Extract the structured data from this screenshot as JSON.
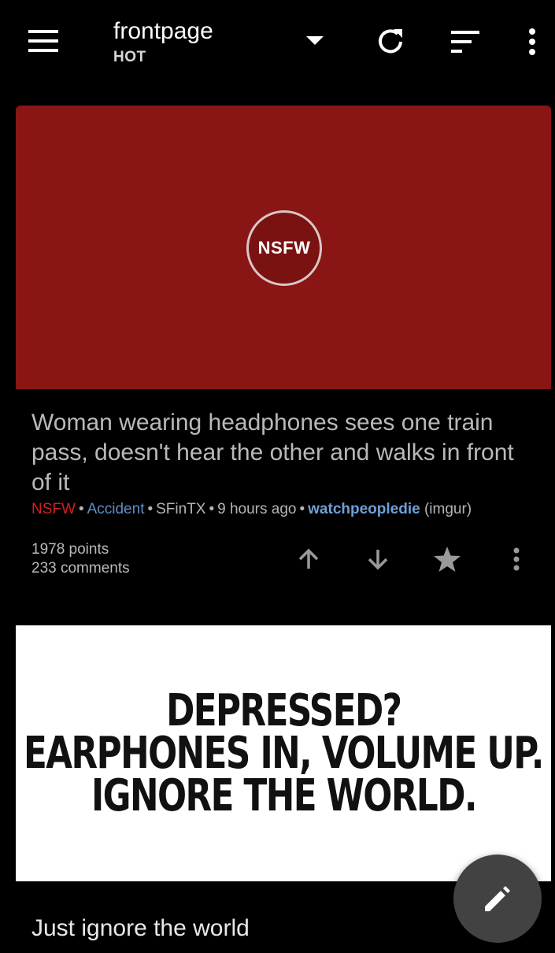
{
  "toolbar": {
    "title": "frontpage",
    "subtitle": "HOT",
    "icons": [
      "menu-icon",
      "dropdown-arrow-icon",
      "refresh-icon",
      "sort-icon",
      "overflow-icon"
    ]
  },
  "posts": [
    {
      "thumbnail_label": "NSFW",
      "title": "Woman wearing headphones sees one train pass, doesn't hear the other and walks in front of it",
      "nsfw_tag": "NSFW",
      "flair": "Accident",
      "author": "SFinTX",
      "time": "9 hours ago",
      "subreddit": "watchpeopledie",
      "domain": "(imgur)",
      "points": "1978 points",
      "comments": "233 comments"
    },
    {
      "image_text": [
        "DEPRESSED?",
        "EARPHONES IN, VOLUME UP.",
        "IGNORE THE WORLD."
      ],
      "title": "Just ignore the world"
    }
  ],
  "colors": {
    "background": "#000000",
    "nsfw_red": "#d22121",
    "thumbnail_red": "#8a1515",
    "link_blue": "#6e9fd6",
    "fab": "#424242"
  }
}
